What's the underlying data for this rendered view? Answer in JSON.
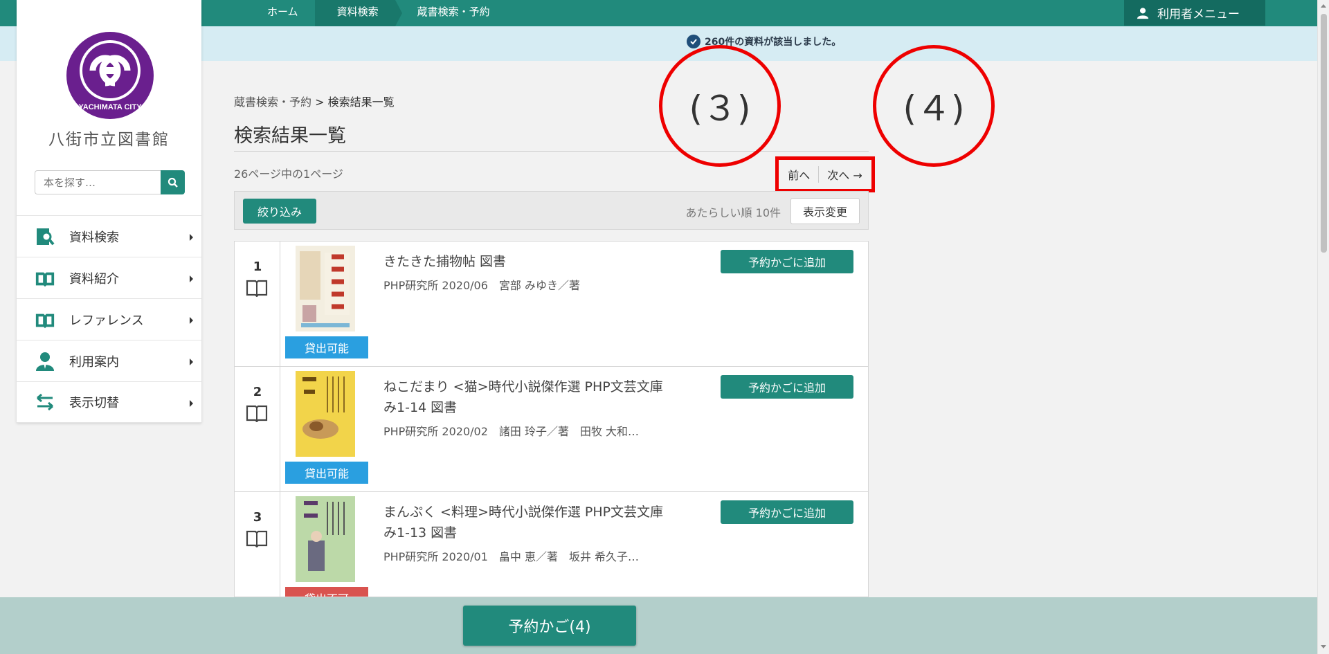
{
  "topbar": {
    "crumbs": [
      "ホーム",
      "資料検索",
      "蔵書検索・予約"
    ],
    "user_menu": "利用者メニュー"
  },
  "notice": {
    "text": "260件の資料が該当しました。"
  },
  "sidebar": {
    "logo_text": "YACHIMATA CITY",
    "library_name": "八街市立図書館",
    "search_placeholder": "本を探す…",
    "items": [
      {
        "label": "資料検索",
        "icon": "book-search-icon"
      },
      {
        "label": "資料紹介",
        "icon": "open-book-icon"
      },
      {
        "label": "レファレンス",
        "icon": "open-book-icon"
      },
      {
        "label": "利用案内",
        "icon": "person-icon"
      },
      {
        "label": "表示切替",
        "icon": "swap-arrows-icon"
      }
    ]
  },
  "main": {
    "breadcrumb": {
      "link": "蔵書検索・予約",
      "sep": ">",
      "current": "検索結果一覧"
    },
    "title": "検索結果一覧",
    "page_info": "26ページ中の1ページ",
    "pager": {
      "prev": "前へ",
      "next": "次へ →"
    },
    "annotations": [
      "(３)",
      "(４)"
    ],
    "filter_button": "絞り込み",
    "sort_info": "あたらしい順 10件",
    "view_button": "表示変更"
  },
  "results": [
    {
      "num": "1",
      "title": "きたきた捕物帖 図書",
      "meta": "PHP研究所 2020/06　宮部 みゆき／著",
      "status": "貸出可能",
      "status_type": "ok",
      "add_button": "予約かごに追加",
      "cover_color": "#f3eee0"
    },
    {
      "num": "2",
      "title": "ねこだまり <猫>時代小説傑作選 PHP文芸文庫 み1-14 図書",
      "meta": "PHP研究所 2020/02　諸田 玲子／著　田牧 大和…",
      "status": "貸出可能",
      "status_type": "ok",
      "add_button": "予約かごに追加",
      "cover_color": "#f2d44a"
    },
    {
      "num": "3",
      "title": "まんぷく <料理>時代小説傑作選 PHP文芸文庫 み1-13 図書",
      "meta": "PHP研究所 2020/01　畠中 恵／著　坂井 希久子…",
      "status": "貸出不可",
      "status_type": "ng",
      "add_button": "予約かごに追加",
      "cover_color": "#bcd9a8"
    }
  ],
  "cart": {
    "label": "予約かご(4)"
  },
  "colors": {
    "brand": "#218a7c",
    "notice_bg": "#d6ecf3",
    "highlight": "#ee0000",
    "status_ok": "#2a9fe0",
    "status_ng": "#d9534f"
  }
}
